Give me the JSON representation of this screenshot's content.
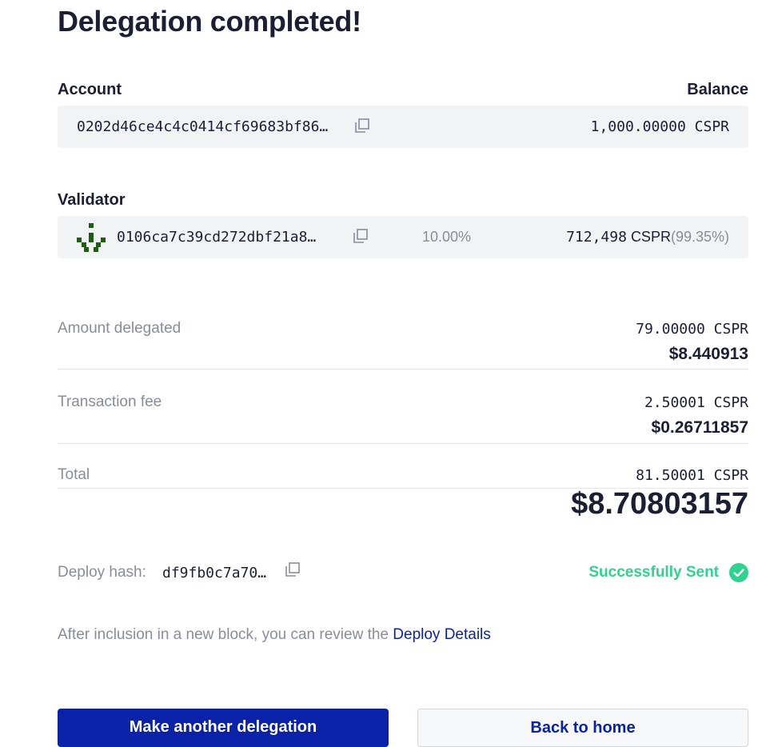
{
  "title": "Delegation completed!",
  "account": {
    "label": "Account",
    "balance_label": "Balance",
    "key": "0202d46ce4c4c0414cf69683bf86…",
    "balance": "1,000.00000 CSPR"
  },
  "validator": {
    "label": "Validator",
    "key": "0106ca7c39cd272dbf21a8…",
    "fee": "10.00%",
    "stake": "712,498",
    "stake_unit": "CSPR",
    "share": "(99.35%)"
  },
  "amount": {
    "label": "Amount delegated",
    "cspr": "79.00000 CSPR",
    "usd": "$8.440913"
  },
  "fee": {
    "label": "Transaction fee",
    "cspr": "2.50001 CSPR",
    "usd": "$0.26711857"
  },
  "total": {
    "label": "Total",
    "cspr": "81.50001 CSPR",
    "usd": "$8.70803157"
  },
  "deploy": {
    "label": "Deploy hash:",
    "hash": "df9fb0c7a70…",
    "status": "Successfully Sent"
  },
  "note": {
    "text": "After inclusion in a new block, you can review the ",
    "link": "Deploy Details"
  },
  "buttons": {
    "primary": "Make another delegation",
    "secondary": "Back to home"
  },
  "colors": {
    "accent": "#0a22a7",
    "success": "#2fd28f",
    "validator_avatar": "#1f5e12"
  },
  "icons": [
    "copy-icon",
    "check-circle-icon",
    "validator-avatar-icon"
  ]
}
